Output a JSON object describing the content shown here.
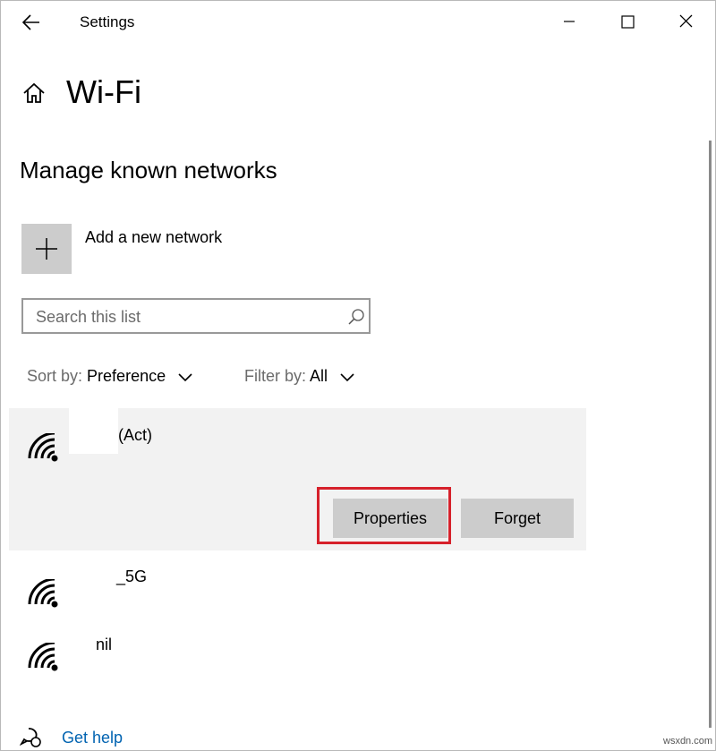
{
  "window": {
    "title": "Settings",
    "controls": {
      "minimize": "minimize",
      "maximize": "maximize",
      "close": "close"
    }
  },
  "page": {
    "title": "Wi-Fi",
    "section_title": "Manage known networks"
  },
  "add_network": {
    "label": "Add a new network"
  },
  "search": {
    "placeholder": "Search this list",
    "value": ""
  },
  "sort": {
    "label": "Sort by:",
    "value": "Preference"
  },
  "filter": {
    "label": "Filter by:",
    "value": "All"
  },
  "networks": [
    {
      "name": "(Act)",
      "expanded": true,
      "actions": [
        "Properties",
        "Forget"
      ]
    },
    {
      "name": "_5G"
    },
    {
      "name": "nil"
    }
  ],
  "help": {
    "label": "Get help"
  },
  "watermark": "wsxdn.com",
  "colors": {
    "accent": "#0063b1",
    "highlight": "#d6212b",
    "tile": "#cccccc",
    "selected_bg": "#f2f2f2"
  },
  "icons": [
    "back-arrow-icon",
    "minimize-icon",
    "maximize-icon",
    "close-icon",
    "home-icon",
    "plus-icon",
    "search-icon",
    "chevron-down-icon",
    "wifi-icon",
    "help-icon"
  ]
}
